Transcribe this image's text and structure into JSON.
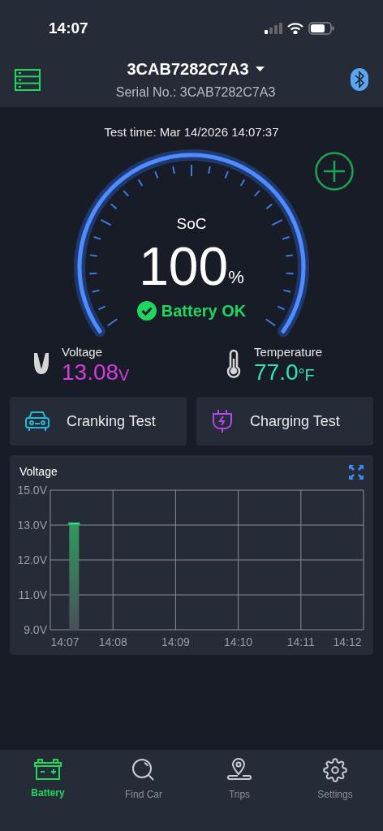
{
  "status_bar": {
    "time": "14:07"
  },
  "header": {
    "device": "3CAB7282C7A3",
    "serial": "Serial No.: 3CAB7282C7A3"
  },
  "test_time": "Test time: Mar 14/2026 14:07:37",
  "soc": {
    "label": "SoC",
    "value": "100",
    "unit": "%",
    "status": "Battery OK"
  },
  "readings": [
    {
      "kind": "voltage",
      "label": "Voltage",
      "value": "13.08",
      "unit": "V",
      "color": "#d63ce0"
    },
    {
      "kind": "temperature",
      "label": "Temperature",
      "value": "77.0",
      "unit": "°F",
      "color": "#2ee6b0"
    }
  ],
  "tests": [
    {
      "kind": "cranking",
      "label": "Cranking Test"
    },
    {
      "kind": "charging",
      "label": "Charging Test"
    }
  ],
  "chart": {
    "title": "Voltage",
    "y_labels": [
      "15.0V",
      "13.0V",
      "12.0V",
      "11.0V",
      "9.0V"
    ],
    "x_labels": [
      "14:07",
      "14:08",
      "14:09",
      "14:10",
      "14:11",
      "14:12"
    ]
  },
  "nav": [
    {
      "kind": "battery",
      "label": "Battery",
      "selected": true
    },
    {
      "kind": "search",
      "label": "Find Car",
      "selected": false
    },
    {
      "kind": "trips",
      "label": "Trips",
      "selected": false
    },
    {
      "kind": "settings",
      "label": "Settings",
      "selected": false
    }
  ]
}
